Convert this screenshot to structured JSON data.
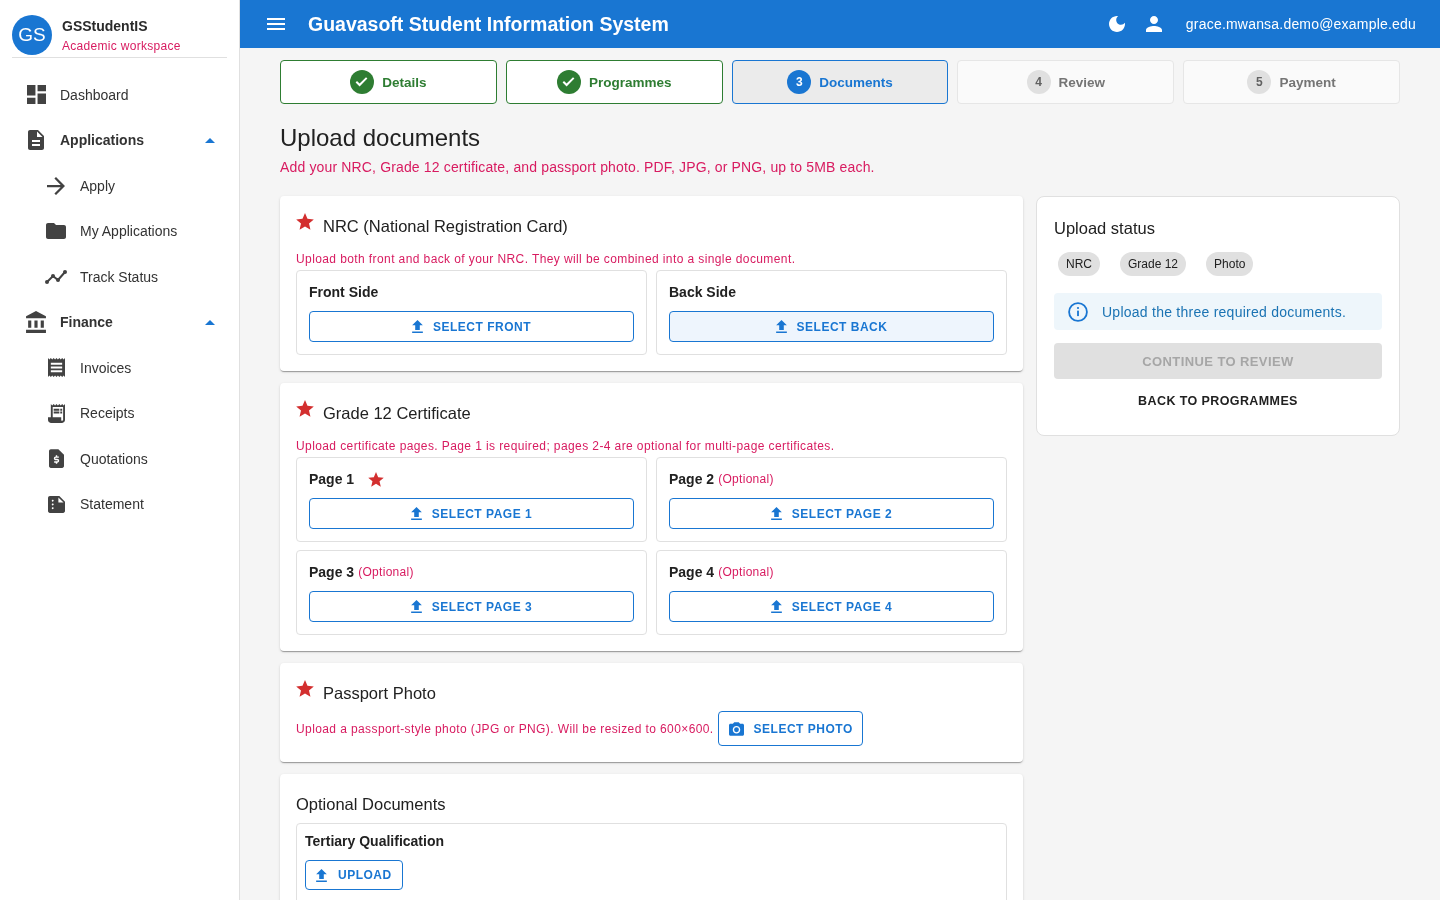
{
  "sidebar": {
    "avatar": "GS",
    "app_name": "GSStudentIS",
    "subtitle": "Academic workspace",
    "items": [
      {
        "label": "Dashboard",
        "selected": false
      },
      {
        "label": "Applications",
        "selected": false,
        "expanded": true,
        "children": [
          {
            "label": "Apply",
            "selected": false
          },
          {
            "label": "My Applications",
            "selected": false
          },
          {
            "label": "Track Status",
            "selected": false
          }
        ]
      },
      {
        "label": "Finance",
        "selected": false,
        "expanded": true,
        "children": [
          {
            "label": "Invoices",
            "selected": false
          },
          {
            "label": "Receipts",
            "selected": false
          },
          {
            "label": "Quotations",
            "selected": false
          },
          {
            "label": "Statement",
            "selected": false
          }
        ]
      }
    ]
  },
  "header": {
    "title": "Guavasoft Student Information System",
    "user_email": "grace.mwansa.demo@example.edu"
  },
  "stepper": [
    {
      "label": "Details",
      "completed": true,
      "selected": false
    },
    {
      "label": "Programmes",
      "completed": true,
      "selected": false
    },
    {
      "number": "3",
      "label": "Documents",
      "completed": false,
      "selected": true
    },
    {
      "number": "4",
      "label": "Review",
      "completed": false,
      "selected": false
    },
    {
      "number": "5",
      "label": "Payment",
      "completed": false,
      "selected": false
    }
  ],
  "page": {
    "title": "Upload documents",
    "subtitle": "Add your NRC, Grade 12 certificate, and passport photo. PDF, JPG, or PNG, up to 5MB each."
  },
  "sections": [
    {
      "kind": "grid",
      "title": "NRC (National Registration Card)",
      "required": true,
      "hint": "Upload both front and back of your NRC. They will be combined into a single document.",
      "slots": [
        {
          "label": "Front Side",
          "required": false,
          "button": "SELECT FRONT",
          "hovered": false
        },
        {
          "label": "Back Side",
          "required": false,
          "button": "SELECT BACK",
          "hovered": true
        }
      ]
    },
    {
      "kind": "grid",
      "title": "Grade 12 Certificate",
      "required": true,
      "hint": "Upload certificate pages. Page 1 is required; pages 2-4 are optional for multi-page certificates.",
      "slots": [
        {
          "label": "Page 1",
          "required": true,
          "button": "SELECT PAGE 1",
          "hovered": false
        },
        {
          "label": "Page 2",
          "note": "(Optional)",
          "required": false,
          "button": "SELECT PAGE 2",
          "hovered": false
        },
        {
          "label": "Page 3",
          "note": "(Optional)",
          "required": false,
          "button": "SELECT PAGE 3",
          "hovered": false
        },
        {
          "label": "Page 4",
          "note": "(Optional)",
          "required": false,
          "button": "SELECT PAGE 4",
          "hovered": false
        }
      ]
    },
    {
      "kind": "inline",
      "title": "Passport Photo",
      "required": true,
      "hint": "Upload a passport-style photo (JPG or PNG). Will be resized to 600×600.",
      "button": "SELECT PHOTO"
    },
    {
      "kind": "compact",
      "title": "Optional Documents",
      "required": false,
      "slots": [
        {
          "label": "Tertiary Qualification",
          "required": false,
          "button": "UPLOAD",
          "hovered": false
        }
      ]
    }
  ],
  "status_panel": {
    "title": "Upload status",
    "chips": [
      {
        "label": "NRC",
        "uploaded": false
      },
      {
        "label": "Grade 12",
        "uploaded": false
      },
      {
        "label": "Photo",
        "uploaded": false
      }
    ],
    "info": "Upload the three required documents.",
    "continue_button": {
      "label": "CONTINUE TO REVIEW",
      "disabled": true
    },
    "back_button": "BACK TO PROGRAMMES"
  }
}
